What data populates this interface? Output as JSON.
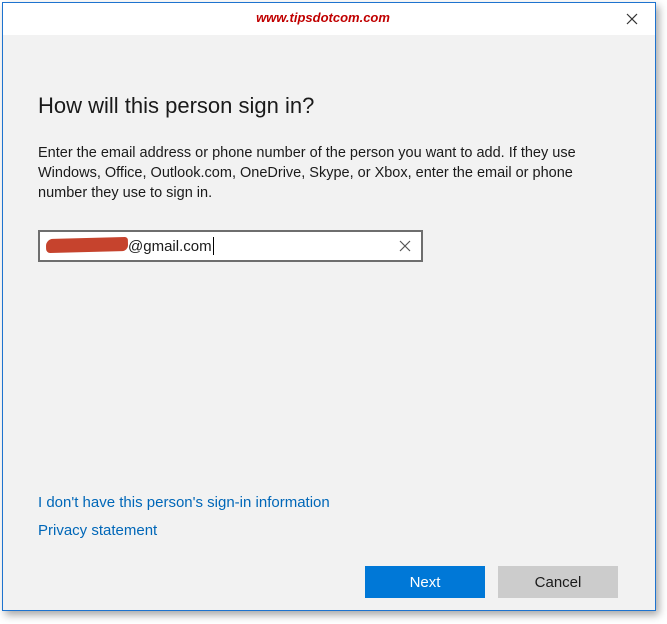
{
  "titlebar": {
    "watermark": "www.tipsdotcom.com",
    "close_icon": "close-icon"
  },
  "dialog": {
    "heading": "How will this person sign in?",
    "description": "Enter the email address or phone number of the person you want to add. If they use Windows, Office, Outlook.com, OneDrive, Skype, or Xbox, enter the email or phone number they use to sign in.",
    "email_input": {
      "value_visible": "@gmail.com",
      "clear_icon": "clear-x-icon"
    },
    "links": {
      "no_info": "I don't have this person's sign-in information",
      "privacy": "Privacy statement"
    },
    "buttons": {
      "next": "Next",
      "cancel": "Cancel"
    }
  },
  "colors": {
    "accent": "#0078d7",
    "link": "#0067b8",
    "watermark": "#c00000",
    "redaction": "#c6432d"
  }
}
